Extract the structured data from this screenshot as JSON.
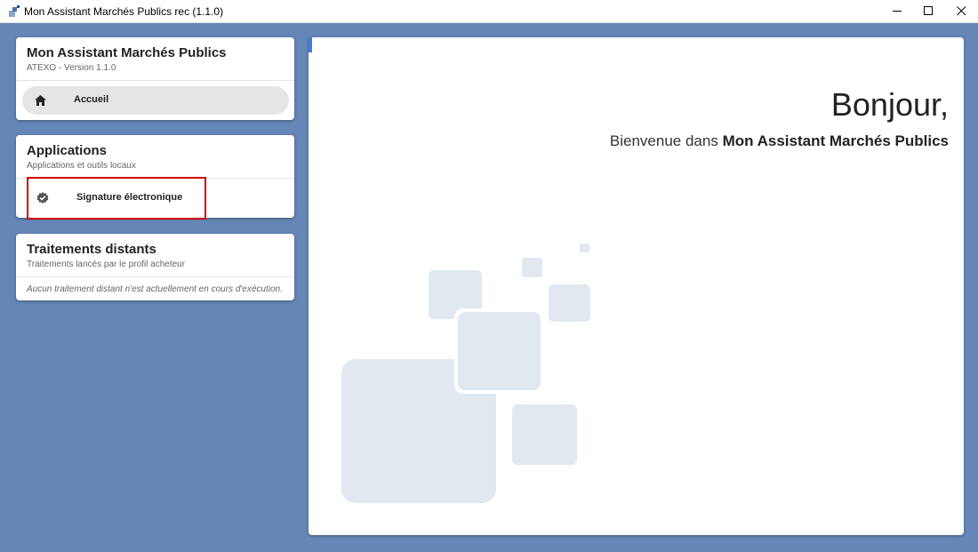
{
  "window": {
    "title": "Mon Assistant Marchés Publics rec (1.1.0)"
  },
  "sidebar": {
    "app_card": {
      "title": "Mon Assistant Marchés Publics",
      "subtitle": "ATEXO - Version 1.1.0",
      "nav_items": [
        {
          "label": "Accueil",
          "icon": "home-icon"
        }
      ]
    },
    "applications_card": {
      "title": "Applications",
      "subtitle": "Applications et outils locaux",
      "items": [
        {
          "label": "Signature électronique",
          "icon": "verified-badge-icon"
        }
      ]
    },
    "remote_card": {
      "title": "Traitements distants",
      "subtitle": "Traitements lancés par le profil acheteur",
      "empty_message": "Aucun traitement distant n'est actuellement en cours d'exécution."
    }
  },
  "main": {
    "greeting": "Bonjour,",
    "welcome_prefix": "Bienvenue dans ",
    "welcome_app": "Mon Assistant Marchés Publics"
  },
  "colors": {
    "background": "#6586b6",
    "highlight_border": "#d50000",
    "decoration": "#e1e8f0"
  }
}
